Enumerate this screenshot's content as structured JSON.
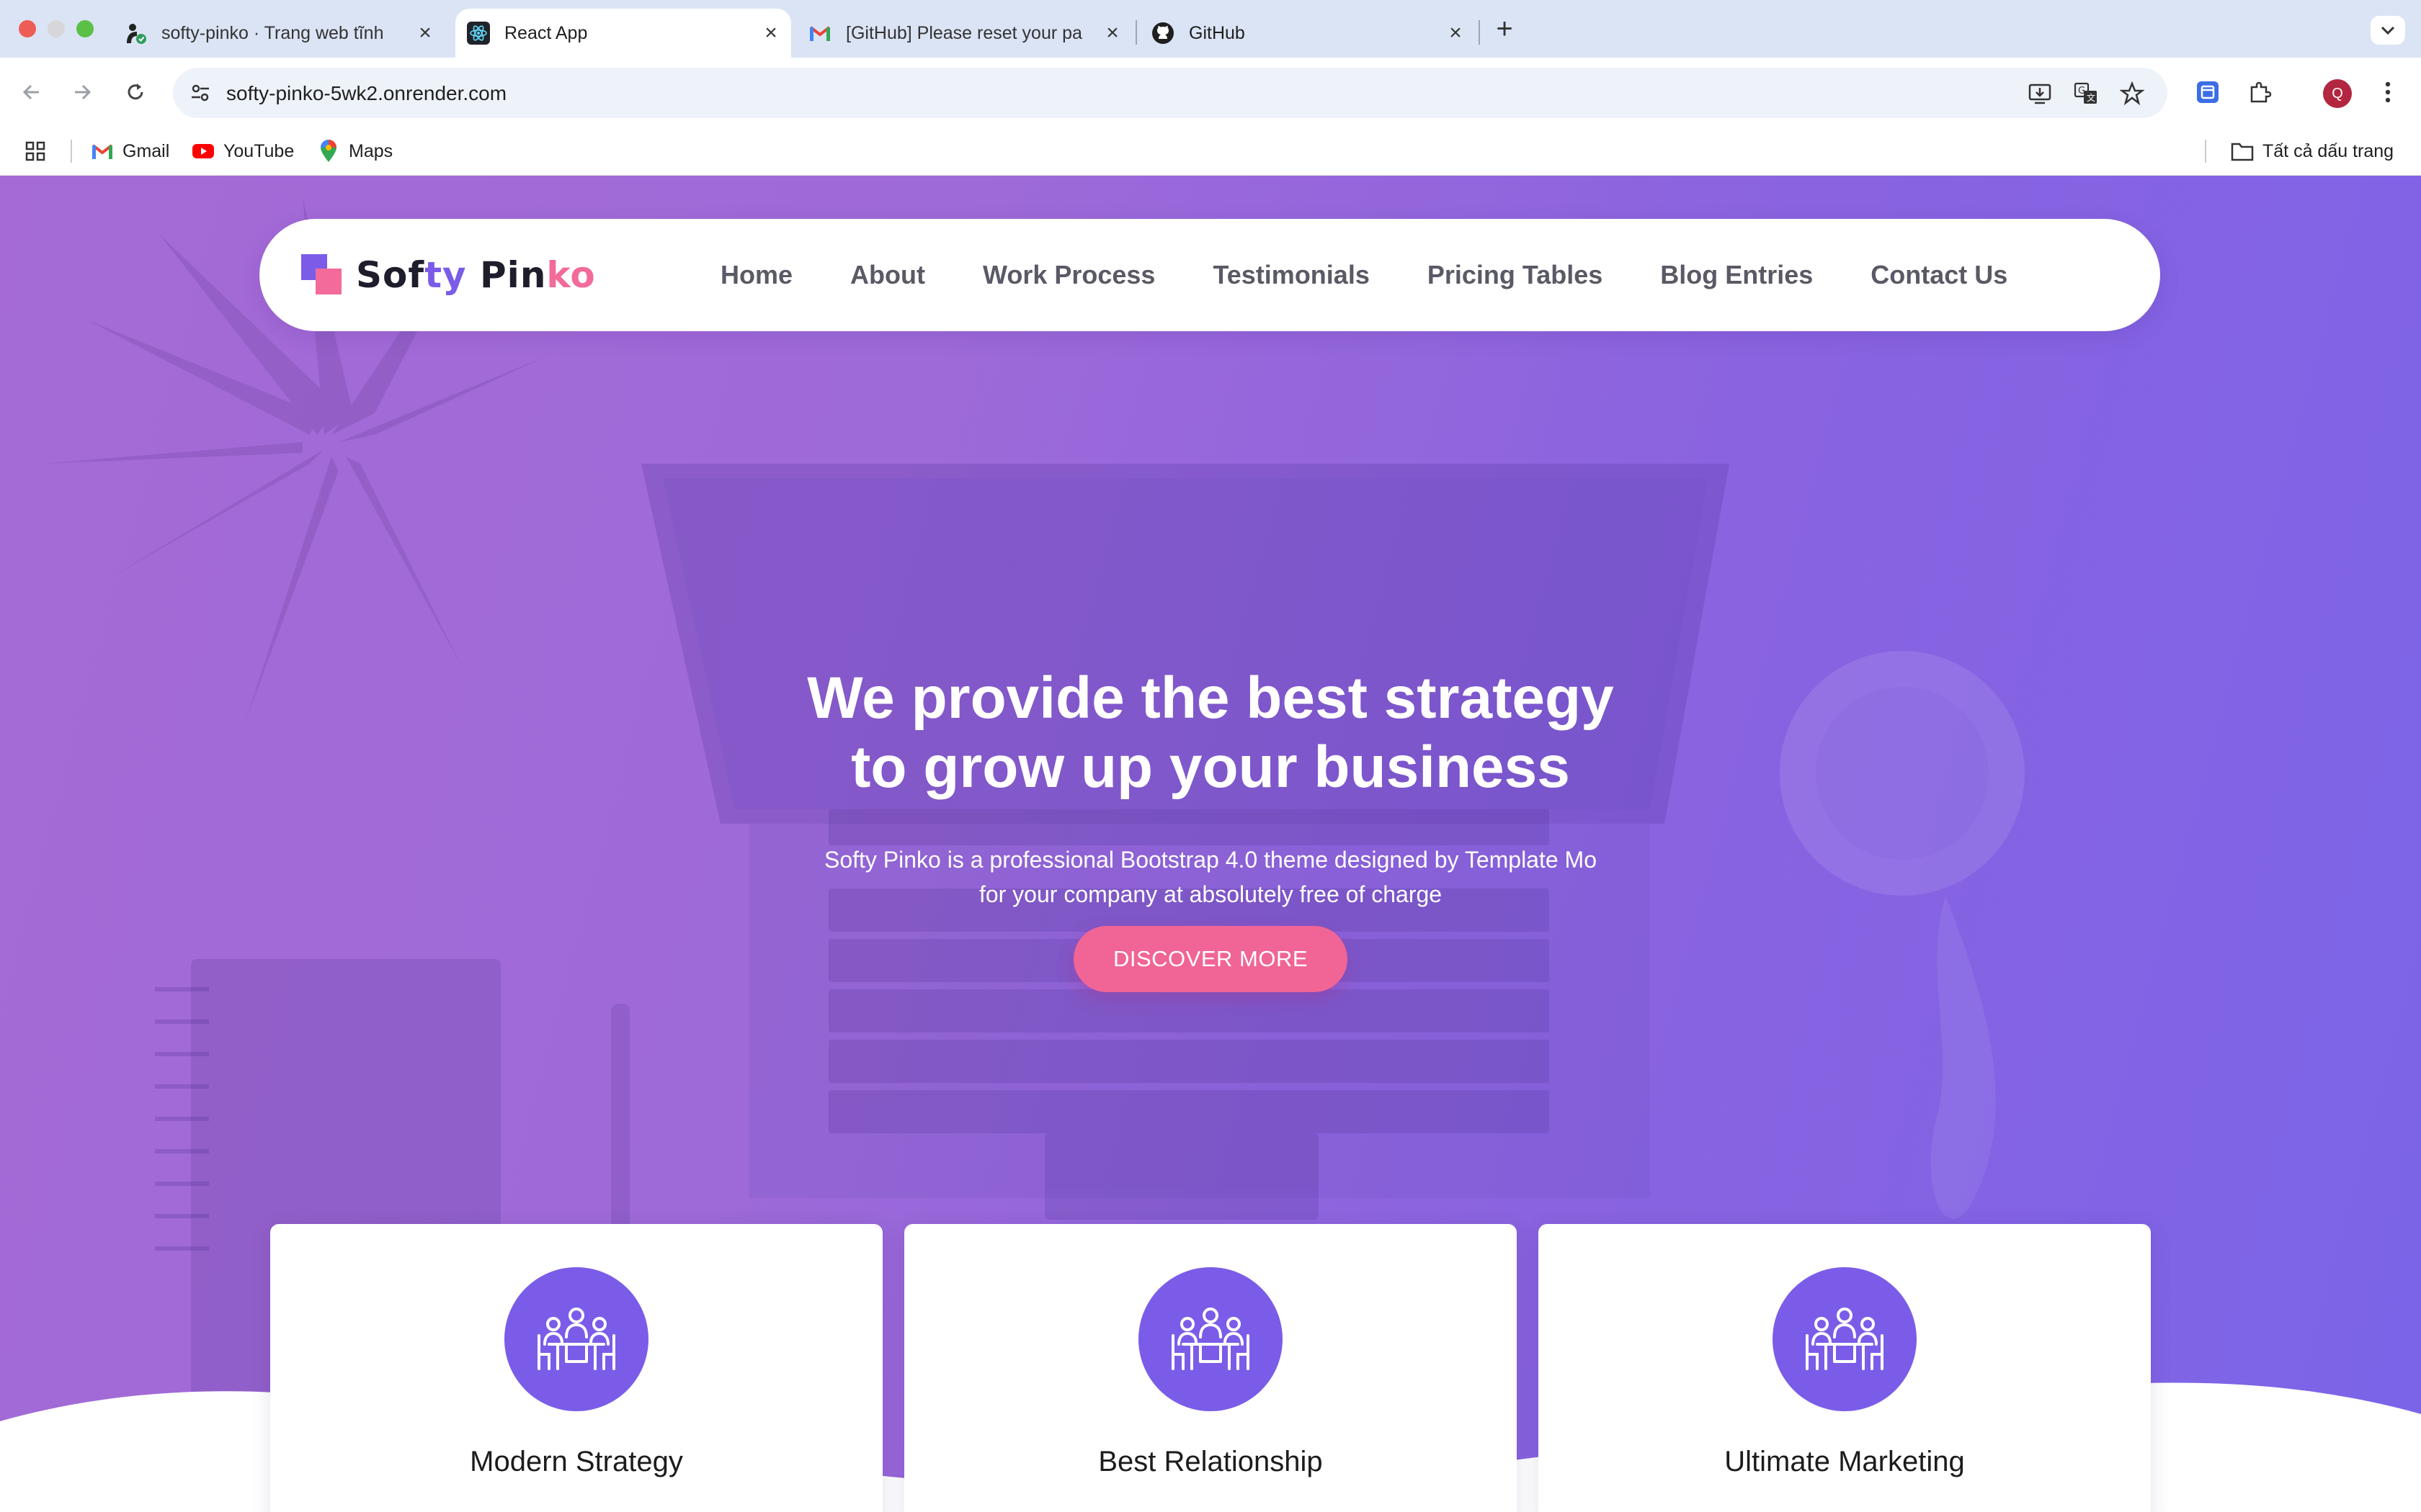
{
  "browser": {
    "tabs": [
      {
        "title": "softy-pinko · Trang web tĩnh",
        "favicon": "render-icon",
        "active": false
      },
      {
        "title": "React App",
        "favicon": "react-icon",
        "active": true
      },
      {
        "title": "[GitHub] Please reset your pa",
        "favicon": "gmail-icon",
        "active": false
      },
      {
        "title": "GitHub",
        "favicon": "github-icon",
        "active": false
      }
    ],
    "url": "softy-pinko-5wk2.onrender.com",
    "profile_initial": "Q",
    "bookmarks": [
      {
        "label": "Gmail",
        "icon": "gmail-icon"
      },
      {
        "label": "YouTube",
        "icon": "youtube-icon"
      },
      {
        "label": "Maps",
        "icon": "maps-icon"
      }
    ],
    "all_bookmarks_label": "Tất cả dấu trang"
  },
  "site": {
    "logo": {
      "part1": "Sof",
      "part2": "ty",
      "part3": " Pin",
      "part4": "ko"
    },
    "nav": [
      "Home",
      "About",
      "Work Process",
      "Testimonials",
      "Pricing Tables",
      "Blog Entries",
      "Contact Us"
    ],
    "hero": {
      "title_line1": "We provide the best strategy",
      "title_line2": "to grow up your business",
      "subtitle_line1": "Softy Pinko is a professional Bootstrap 4.0 theme designed by Template Mo",
      "subtitle_line2": "for your company at absolutely free of charge",
      "cta": "DISCOVER MORE"
    },
    "features": [
      {
        "title": "Modern Strategy",
        "icon": "meeting-team-icon"
      },
      {
        "title": "Best Relationship",
        "icon": "meeting-team-icon"
      },
      {
        "title": "Ultimate Marketing",
        "icon": "meeting-team-icon"
      }
    ]
  },
  "colors": {
    "brand_purple": "#7b5ce8",
    "brand_pink": "#f06595",
    "hero_gradient_start": "#a56ad6",
    "hero_gradient_end": "#7b64e8",
    "tabbar_bg": "#dbe4f5"
  }
}
